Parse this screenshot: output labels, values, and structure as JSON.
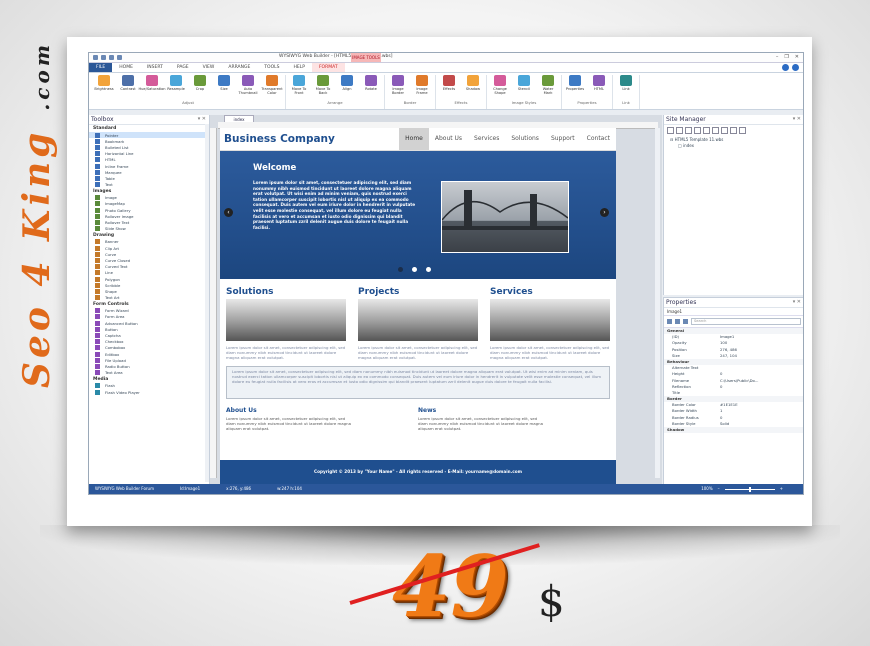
{
  "app": {
    "title": "WYSIWYG Web Builder - [HTML5 Template 11.wbs]",
    "context_tab": "IMAGE TOOLS",
    "window_buttons": [
      "–",
      "❐",
      "✕"
    ]
  },
  "ribbon": {
    "tabs": [
      "FILE",
      "HOME",
      "INSERT",
      "PAGE",
      "VIEW",
      "ARRANGE",
      "TOOLS",
      "HELP",
      "FORMAT"
    ],
    "groups": [
      {
        "name": "Adjust",
        "buttons": [
          "Brightness",
          "Contrast",
          "Hue/Saturation",
          "Resample",
          "Crop",
          "Size",
          "Auto Thumbnail",
          "Transparent Color"
        ]
      },
      {
        "name": "Arrange",
        "buttons": [
          "Move To Front",
          "Move To Back",
          "Align",
          "Rotate"
        ]
      },
      {
        "name": "Border",
        "buttons": [
          "Image Border",
          "Image Frame"
        ]
      },
      {
        "name": "Effects",
        "buttons": [
          "Effects",
          "Shadow"
        ]
      },
      {
        "name": "Image Styles",
        "buttons": [
          "Change Shape",
          "Stencil",
          "Water Mark"
        ]
      },
      {
        "name": "Properties",
        "buttons": [
          "Properties",
          "HTML"
        ]
      },
      {
        "name": "Link",
        "buttons": [
          "Link"
        ]
      }
    ]
  },
  "toolbox": {
    "title": "Toolbox",
    "categories": [
      {
        "name": "Standard",
        "items": [
          "Pointer",
          "Bookmark",
          "Bulleted List",
          "Horizontal Line",
          "HTML",
          "Inline Frame",
          "Marquee",
          "Table",
          "Text"
        ]
      },
      {
        "name": "Images",
        "items": [
          "Image",
          "ImageMap",
          "Photo Gallery",
          "Rollover Image",
          "Rollover Text",
          "Slide Show"
        ]
      },
      {
        "name": "Drawing",
        "items": [
          "Banner",
          "Clip Art",
          "Curve",
          "Curve Closed",
          "Curved Text",
          "Line",
          "Polygon",
          "Scribble",
          "Shape",
          "Text Art"
        ]
      },
      {
        "name": "Form Controls",
        "items": [
          "Form Wizard",
          "Form Area",
          "Advanced Button",
          "Button",
          "Captcha",
          "Checkbox",
          "Combobox",
          "Editbox",
          "File Upload",
          "Radio Button",
          "Text Area"
        ]
      },
      {
        "name": "Media",
        "items": [
          "Flash",
          "Flash Video Player"
        ]
      }
    ]
  },
  "document": {
    "tab": "index"
  },
  "site": {
    "brand": "Business Company",
    "nav": [
      "Home",
      "About Us",
      "Services",
      "Solutions",
      "Support",
      "Contact"
    ],
    "welcome_title": "Welcome",
    "welcome_text": "Lorem ipsum dolor sit amet, consectetuer adipiscing elit, sed diam nonummy nibh euismod tincidunt ut laoreet dolore magna aliquam erat volutpat. Ut wisi enim ad minim veniam, quis nostrud exerci tation ullamcorper suscipit lobortis nisl ut aliquip ex ea commodo consequat. Duis autem vel eum iriure dolor in hendrerit in vulputate velit esse molestie consequat, vel illum dolore eu feugiat nulla facilisis at vero et accumsan et iusto odio dignissim qui blandit praesent luptatum zzril delenit augue duis dolore te feugait nulla facilisi.",
    "columns": [
      {
        "title": "Solutions",
        "text": "Lorem ipsum dolor sit amet, consectetuer adipiscing elit, sed diam nonummy nibh euismod tincidunt ut laoreet dolore magna aliquam erat volutpat."
      },
      {
        "title": "Projects",
        "text": "Lorem ipsum dolor sit amet, consectetuer adipiscing elit, sed diam nonummy nibh euismod tincidunt ut laoreet dolore magna aliquam erat volutpat."
      },
      {
        "title": "Services",
        "text": "Lorem ipsum dolor sit amet, consectetuer adipiscing elit, sed diam nonummy nibh euismod tincidunt ut laoreet dolore magna aliquam erat volutpat."
      }
    ],
    "box_text": "Lorem ipsum dolor sit amet, consectetuer adipiscing elit, sed diam nonummy nibh euismod tincidunt ut laoreet dolore magna aliquam erat volutpat. Ut wisi enim ad minim veniam, quis nostrud exerci tation ullamcorper suscipit lobortis nisl ut aliquip ex ea commodo consequat. Duis autem vel eum iriure dolor in hendrerit in vulputate velit esse molestie consequat, vel illum dolore eu feugiat nulla facilisis at vero eros et accumsan et iusto odio dignissim qui blandit praesent luptatum zzril delenit augue duis dolore te feugait nulla facilisi.",
    "about_title": "About Us",
    "about_text": "Lorem ipsum dolor sit amet, consectetuer adipiscing elit, sed diam nonummy nibh euismod tincidunt ut laoreet dolore magna aliquam erat volutpat.",
    "news_title": "News",
    "news_text": "Lorem ipsum dolor sit amet, consectetuer adipiscing elit, sed diam nonummy nibh euismod tincidunt ut laoreet dolore magna aliquam erat volutpat.",
    "footer": "Copyright © 2013 by \"Your Name\" - All rights reserved - E-Mail: yourname@domain.com",
    "arrow_left": "‹",
    "arrow_right": "›"
  },
  "site_manager": {
    "title": "Site Manager",
    "tree": [
      "HTML5 Template 11.wbs",
      "index"
    ]
  },
  "properties": {
    "title": "Properties",
    "object": "Image1",
    "search_placeholder": "Search",
    "sections": [
      {
        "name": "General",
        "rows": [
          [
            "(ID)",
            "Image1"
          ],
          [
            "Opacity",
            "100"
          ],
          [
            "Position",
            "276, 486"
          ],
          [
            "Size",
            "247, 104"
          ]
        ]
      },
      {
        "name": "Behaviour",
        "rows": [
          [
            "Alternate Text",
            ""
          ],
          [
            "Height",
            "0"
          ],
          [
            "Filename",
            "C:\\Users\\Public\\Do..."
          ],
          [
            "Reflection",
            "0"
          ],
          [
            "Title",
            ""
          ]
        ]
      },
      {
        "name": "Border",
        "rows": [
          [
            "Border Color",
            "#1E1E1E"
          ],
          [
            "Border Width",
            "1"
          ],
          [
            "Border Radius",
            "0"
          ],
          [
            "Border Style",
            "Solid"
          ]
        ]
      },
      {
        "name": "Shadow",
        "rows": []
      }
    ]
  },
  "status": {
    "app_link": "WYSIWYG Web Builder Forum",
    "object": "Id:Image1",
    "pos": "x:276, y:486",
    "size": "w:247 h:104",
    "zoom": "100%",
    "zoom_minus": "–",
    "zoom_plus": "+"
  },
  "promo": {
    "brand_main": "Seo 4 King",
    "brand_suffix": ".com",
    "price": "49",
    "currency": "$",
    "brand_color": "#e06a1b",
    "price_color": "#f07a16",
    "strike_color": "#e02020"
  }
}
